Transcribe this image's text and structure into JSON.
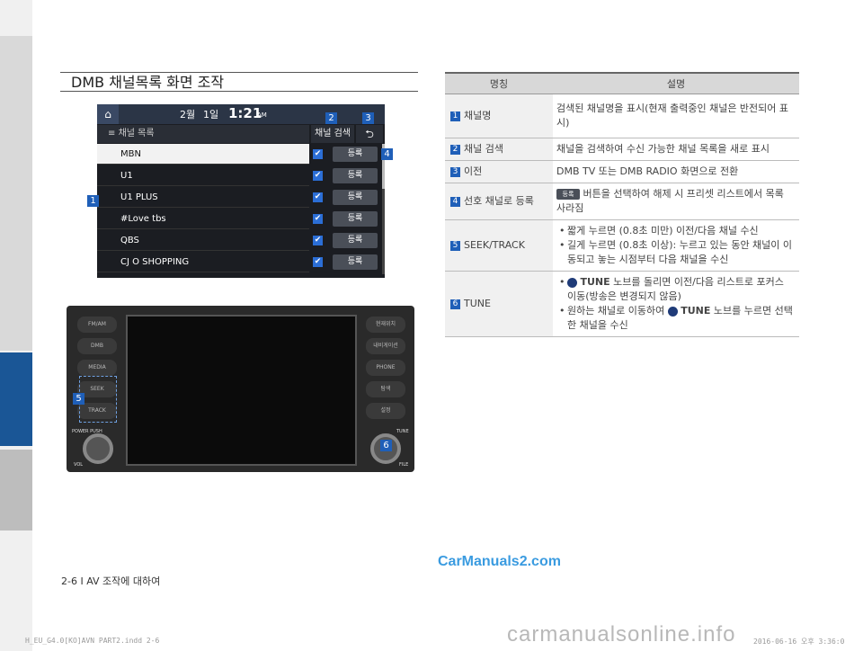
{
  "section_title": "DMB 채널목록 화면 조작",
  "screen": {
    "month": "2월",
    "day": "1일",
    "time": "1:21",
    "ampm": "AM",
    "list_header": "채널 목록",
    "search_label": "채널 검색",
    "back_symbol": "⮌",
    "home_symbol": "⌂",
    "register_label": "등록",
    "check_symbol": "✔",
    "channels": [
      "MBN",
      "U1",
      "U1 PLUS",
      "#Love tbs",
      "QBS",
      "CJ O SHOPPING"
    ],
    "selected_index": 0
  },
  "callouts": {
    "n1": "1",
    "n2": "2",
    "n3": "3",
    "n4": "4",
    "n5": "5",
    "n6": "6"
  },
  "head_unit": {
    "left_buttons": [
      "FM/AM",
      "DMB",
      "MEDIA",
      "SEEK",
      "TRACK"
    ],
    "right_buttons": [
      "현재위치",
      "내비게이션",
      "PHONE",
      "탐색",
      "설정"
    ],
    "power": "POWER PUSH",
    "vol": "VOL",
    "tune": "TUNE",
    "file": "FILE"
  },
  "table": {
    "header_name": "명칭",
    "header_desc": "설명",
    "rows": [
      {
        "num": "1",
        "name": "채널명",
        "desc": "검색된 채널명을 표시(현재 출력중인 채널은 반전되어 표시)"
      },
      {
        "num": "2",
        "name": "채널 검색",
        "desc": "채널을 검색하여 수신 가능한 채널 목록을 새로 표시"
      },
      {
        "num": "3",
        "name": "이전",
        "desc": "DMB TV 또는 DMB RADIO 화면으로 전환"
      },
      {
        "num": "4",
        "name": "선호 채널로 등록",
        "icon": "등록",
        "desc": "버튼을 선택하여 해제 시 프리셋 리스트에서 목록 사라짐"
      },
      {
        "num": "5",
        "name": "SEEK/TRACK",
        "bullets": [
          "짧게 누르면 (0.8초 미만) 이전/다음 채널 수신",
          "길게 누르면 (0.8초 이상): 누르고 있는 동안 채널이 이동되고 놓는 시점부터 다음 채널을 수신"
        ]
      },
      {
        "num": "6",
        "name": "TUNE",
        "tune_word": "TUNE",
        "b1_after": "노브를 돌리면 이전/다음 리스트로 포커스 이동(방송은 변경되지 않음)",
        "b2_before": "원하는 채널로 이동하여",
        "b2_after": "노브를 누르면 선택한 채널을 수신"
      }
    ]
  },
  "footer": "2-6 I AV 조작에 대하여",
  "watermark": "CarManuals2.com",
  "watermark2": "carmanualsonline.info",
  "print_info": "H_EU_G4.0[KO]AVN PART2.indd   2-6",
  "print_date": "2016-06-16   오후 3:36:0"
}
